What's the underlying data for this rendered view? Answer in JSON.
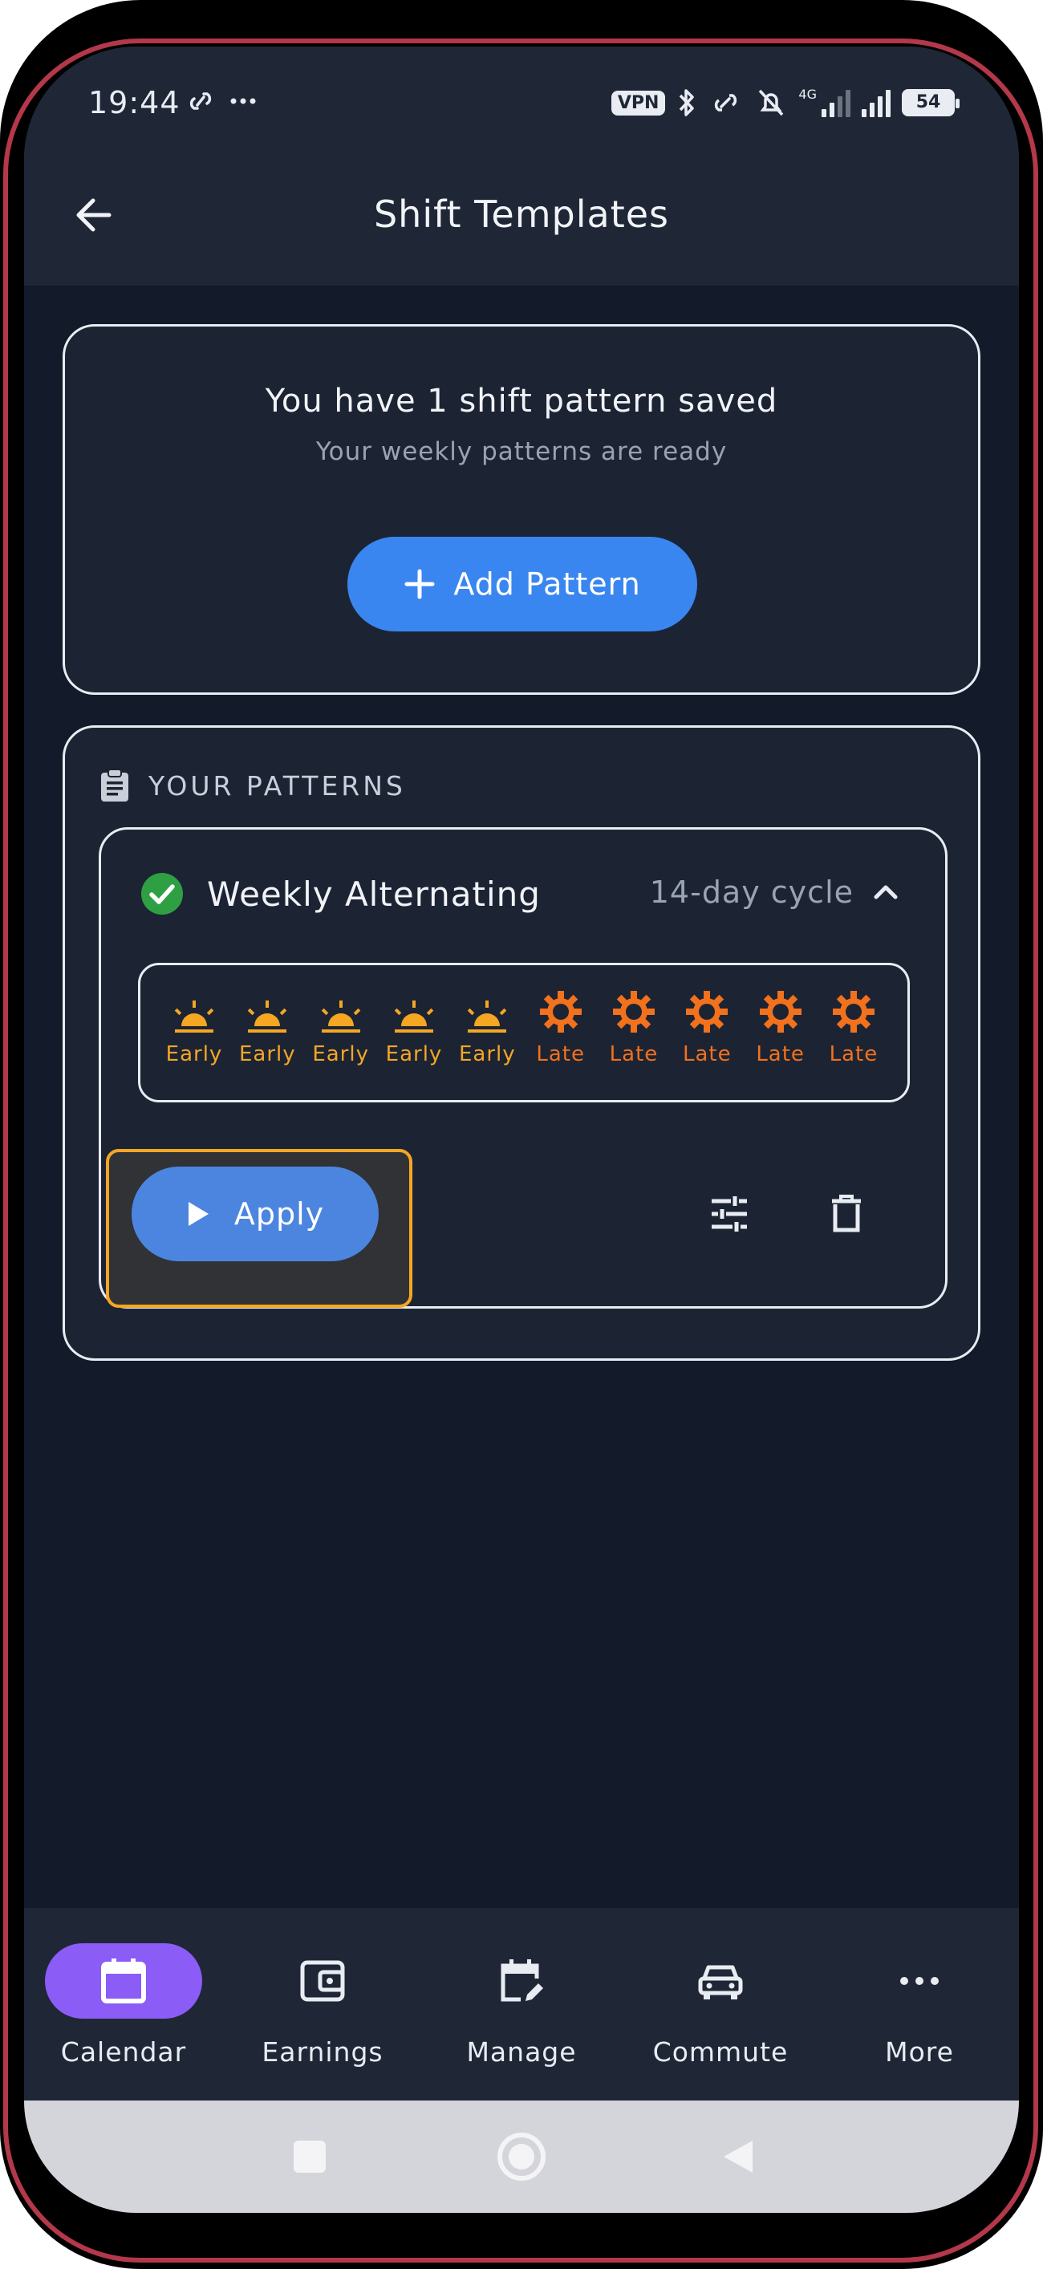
{
  "status_bar": {
    "time": "19:44",
    "left_icons": [
      "link-icon",
      "more-dots-icon"
    ],
    "left_glyphs": "⊘ ···",
    "vpn": "VPN",
    "network": "4G",
    "battery": "54"
  },
  "app_bar": {
    "back_icon": "arrow-left-icon",
    "title": "Shift Templates"
  },
  "summary": {
    "title": "You have 1 shift pattern saved",
    "subtitle": "Your weekly patterns are ready",
    "add_button": "Add Pattern"
  },
  "patterns_section": {
    "label": "YOUR PATTERNS",
    "icon": "clipboard-icon"
  },
  "patterns": [
    {
      "name": "Weekly Alternating",
      "cycle": "14-day cycle",
      "status_icon": "check-circle-icon",
      "expanded": true,
      "days": [
        {
          "label": "Early",
          "type": "early",
          "icon": "sunrise-icon"
        },
        {
          "label": "Early",
          "type": "early",
          "icon": "sunrise-icon"
        },
        {
          "label": "Early",
          "type": "early",
          "icon": "sunrise-icon"
        },
        {
          "label": "Early",
          "type": "early",
          "icon": "sunrise-icon"
        },
        {
          "label": "Early",
          "type": "early",
          "icon": "sunrise-icon"
        },
        {
          "label": "Late",
          "type": "late",
          "icon": "sun-icon"
        },
        {
          "label": "Late",
          "type": "late",
          "icon": "sun-icon"
        },
        {
          "label": "Late",
          "type": "late",
          "icon": "sun-icon"
        },
        {
          "label": "Late",
          "type": "late",
          "icon": "sun-icon"
        },
        {
          "label": "Late",
          "type": "late",
          "icon": "sun-icon"
        }
      ],
      "apply_button": "Apply"
    }
  ],
  "bottom_nav": [
    {
      "label": "Calendar",
      "icon": "calendar-icon",
      "active": true
    },
    {
      "label": "Earnings",
      "icon": "wallet-icon",
      "active": false
    },
    {
      "label": "Manage",
      "icon": "calendar-edit-icon",
      "active": false
    },
    {
      "label": "Commute",
      "icon": "car-icon",
      "active": false
    },
    {
      "label": "More",
      "icon": "more-horizontal-icon",
      "active": false
    }
  ],
  "colors": {
    "background": "#131a2a",
    "surface": "#1f2737",
    "card": "#1c2434",
    "primary": "#3a86f0",
    "nav_active": "#8b5cf6",
    "early": "#f5a623",
    "late": "#f2711c",
    "success": "#2ea043",
    "focus": "#f5a623"
  }
}
